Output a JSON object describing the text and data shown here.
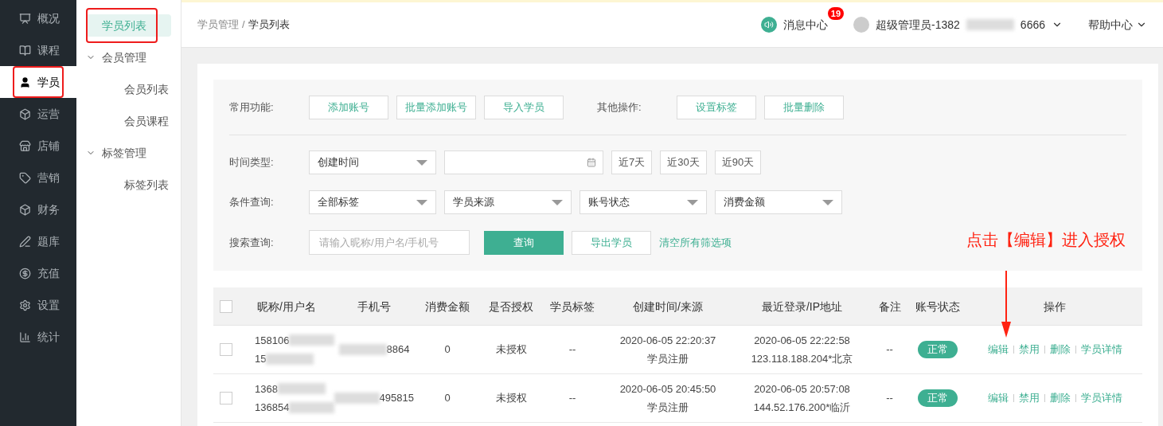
{
  "nav": [
    {
      "kind": "overview",
      "label": "概况",
      "selected": false
    },
    {
      "kind": "book",
      "label": "课程",
      "selected": false
    },
    {
      "kind": "user",
      "label": "学员",
      "selected": true
    },
    {
      "kind": "cube",
      "label": "运营",
      "selected": false
    },
    {
      "kind": "store",
      "label": "店铺",
      "selected": false
    },
    {
      "kind": "tag",
      "label": "营销",
      "selected": false
    },
    {
      "kind": "cube",
      "label": "财务",
      "selected": false
    },
    {
      "kind": "pen",
      "label": "题库",
      "selected": false
    },
    {
      "kind": "yen",
      "label": "充值",
      "selected": false
    },
    {
      "kind": "gear",
      "label": "设置",
      "selected": false
    },
    {
      "kind": "chart",
      "label": "统计",
      "selected": false
    }
  ],
  "submenu": [
    {
      "kind": "item",
      "label": "学员列表",
      "selected": true
    },
    {
      "kind": "group",
      "label": "会员管理",
      "expanded": true,
      "children": [
        {
          "label": "会员列表",
          "selected": false
        },
        {
          "label": "会员课程",
          "selected": false
        }
      ]
    },
    {
      "kind": "group",
      "label": "标签管理",
      "expanded": true,
      "children": [
        {
          "label": "标签列表",
          "selected": false
        }
      ]
    }
  ],
  "header": {
    "breadcrumb": [
      "学员管理",
      "学员列表"
    ],
    "separator": "/",
    "messages": {
      "label": "消息中心",
      "badge": "19"
    },
    "user": {
      "name_start": "超级管理员-1382",
      "name_end": "6666"
    },
    "help": "帮助中心"
  },
  "filters": {
    "common": {
      "label": "常用功能:",
      "buttons": [
        "添加账号",
        "批量添加账号",
        "导入学员"
      ]
    },
    "other": {
      "label": "其他操作:",
      "buttons": [
        "设置标签",
        "批量删除"
      ]
    },
    "time": {
      "label": "时间类型:",
      "select": "创建时间",
      "ranges": [
        "近7天",
        "近30天",
        "近90天"
      ]
    },
    "conditions": {
      "label": "条件查询:",
      "selects": [
        "全部标签",
        "学员来源",
        "账号状态",
        "消费金额"
      ]
    },
    "search": {
      "label": "搜索查询:",
      "placeholder": "请输入昵称/用户名/手机号",
      "submit": "查询",
      "export": "导出学员",
      "clear": "清空所有筛选项"
    }
  },
  "annotation": {
    "text": "点击【编辑】进入授权"
  },
  "table": {
    "columns": [
      "昵称/用户名",
      "手机号",
      "消费金额",
      "是否授权",
      "学员标签",
      "创建时间/来源",
      "最近登录/IP地址",
      "备注",
      "账号状态",
      "操作"
    ],
    "header_checked": false,
    "rows": [
      {
        "checked": false,
        "name": [
          "158106",
          "15"
        ],
        "phone": "8864",
        "amount": "0",
        "auth": "未授权",
        "tags": "--",
        "created": [
          "2020-06-05 22:20:37",
          "学员注册"
        ],
        "login": [
          "2020-06-05 22:22:58",
          "123.118.188.204*北京"
        ],
        "remark": "--",
        "status": "正常",
        "actions": [
          "编辑",
          "禁用",
          "删除",
          "学员详情"
        ]
      },
      {
        "checked": false,
        "name": [
          "1368",
          "136854"
        ],
        "phone": "495815",
        "amount": "0",
        "auth": "未授权",
        "tags": "--",
        "created": [
          "2020-06-05 20:45:50",
          "学员注册"
        ],
        "login": [
          "2020-06-05 20:57:08",
          "144.52.176.200*临沂"
        ],
        "remark": "--",
        "status": "正常",
        "actions": [
          "编辑",
          "禁用",
          "删除",
          "学员详情"
        ]
      }
    ]
  }
}
